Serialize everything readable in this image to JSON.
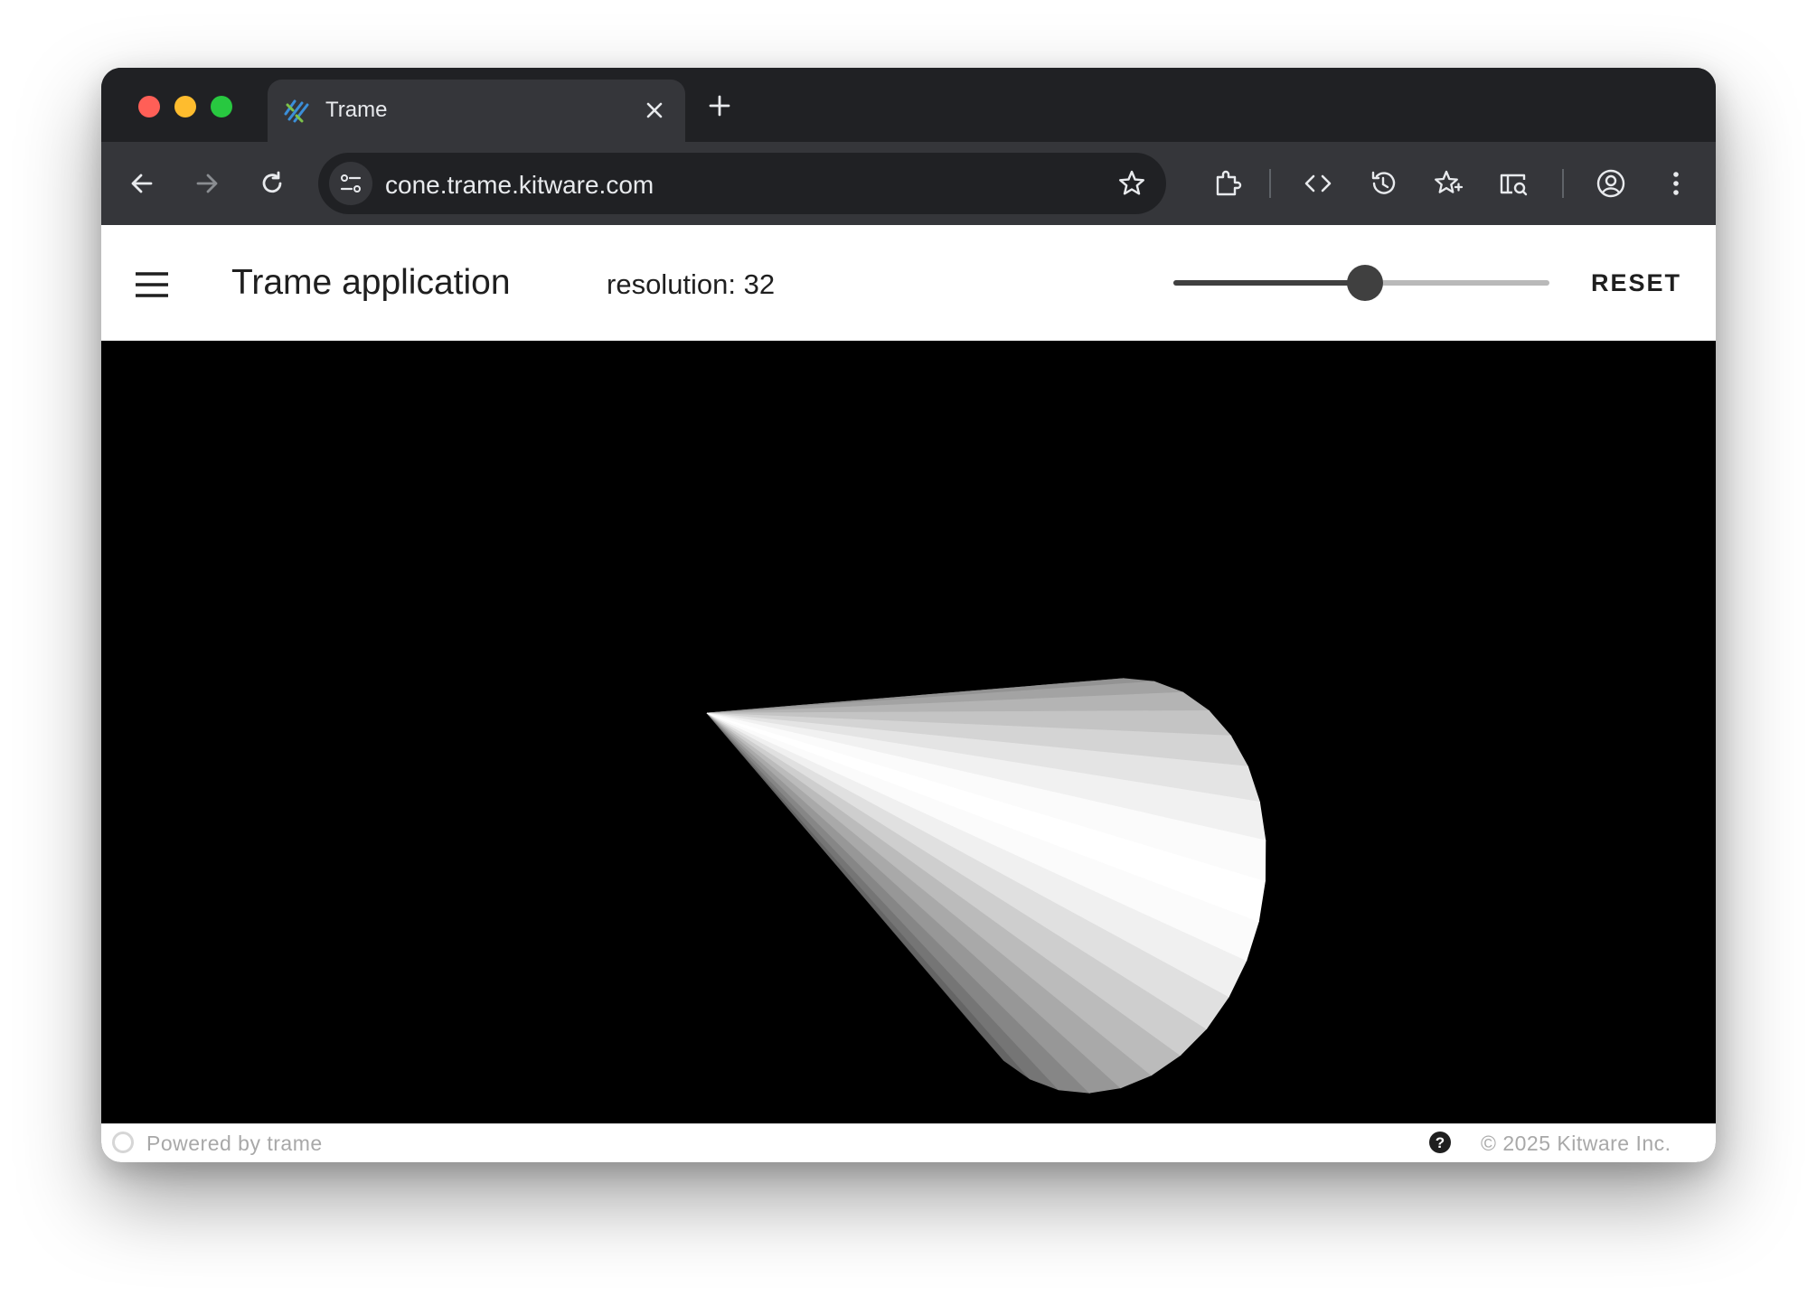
{
  "browser": {
    "tab_title": "Trame",
    "url": "cone.trame.kitware.com",
    "icons": [
      "close-icon",
      "plus-icon",
      "back-arrow-icon",
      "forward-arrow-icon",
      "reload-icon",
      "site-settings-icon",
      "star-icon",
      "extensions-icon",
      "code-icon",
      "history-icon",
      "favorites-icon",
      "search-panel-icon",
      "profile-icon",
      "more-vert-icon"
    ]
  },
  "app": {
    "title": "Trame application",
    "resolution_label": "resolution: 32",
    "slider": {
      "value": 32,
      "min": 3,
      "max": 60
    },
    "reset_label": "RESET"
  },
  "footer": {
    "powered": "Powered by trame",
    "copyright": "© 2025 Kitware Inc."
  },
  "colors": {
    "viewport_bg": "#000000",
    "slider_active": "#404040",
    "slider_track": "#b9b9b9",
    "browser_frame": "#202124",
    "toolbar": "#35363a"
  }
}
